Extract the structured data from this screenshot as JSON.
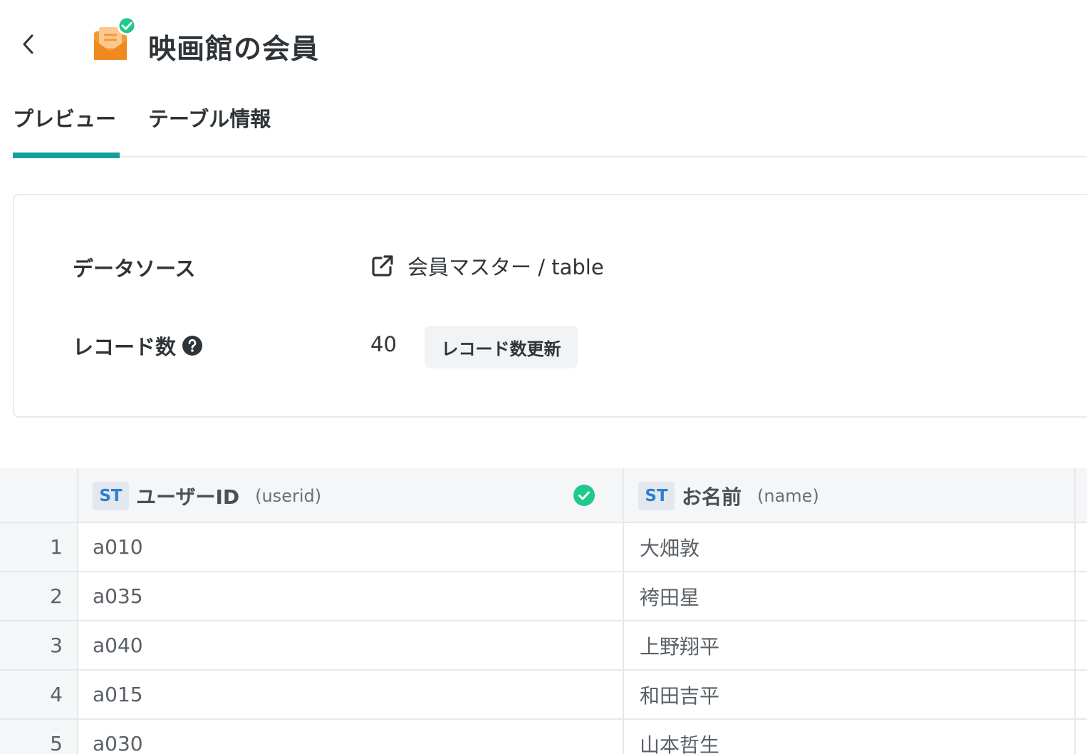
{
  "header": {
    "title": "映画館の会員",
    "icon": "envelope-verified-icon",
    "back_icon": "chevron-left-icon"
  },
  "tabs": [
    {
      "label": "プレビュー",
      "active": true
    },
    {
      "label": "テーブル情報",
      "active": false
    }
  ],
  "info": {
    "datasource_label": "データソース",
    "datasource_value": "会員マスター / table",
    "record_count_label": "レコード数",
    "record_count_value": "40",
    "refresh_button": "レコード数更新"
  },
  "table": {
    "columns": [
      {
        "type": "ST",
        "name": "ユーザーID",
        "key": "(userid)",
        "verified": true
      },
      {
        "type": "ST",
        "name": "お名前",
        "key": "(name)",
        "verified": false
      }
    ],
    "rows": [
      {
        "index": "1",
        "userid": "a010",
        "name": "大畑敦"
      },
      {
        "index": "2",
        "userid": "a035",
        "name": "袴田星"
      },
      {
        "index": "3",
        "userid": "a040",
        "name": "上野翔平"
      },
      {
        "index": "4",
        "userid": "a015",
        "name": "和田吉平"
      },
      {
        "index": "5",
        "userid": "a030",
        "name": "山本哲生"
      }
    ]
  },
  "colors": {
    "accent": "#17a09a",
    "badge_text": "#2f7fd0",
    "check": "#1fc98c",
    "icon_orange": "#f29a38"
  }
}
